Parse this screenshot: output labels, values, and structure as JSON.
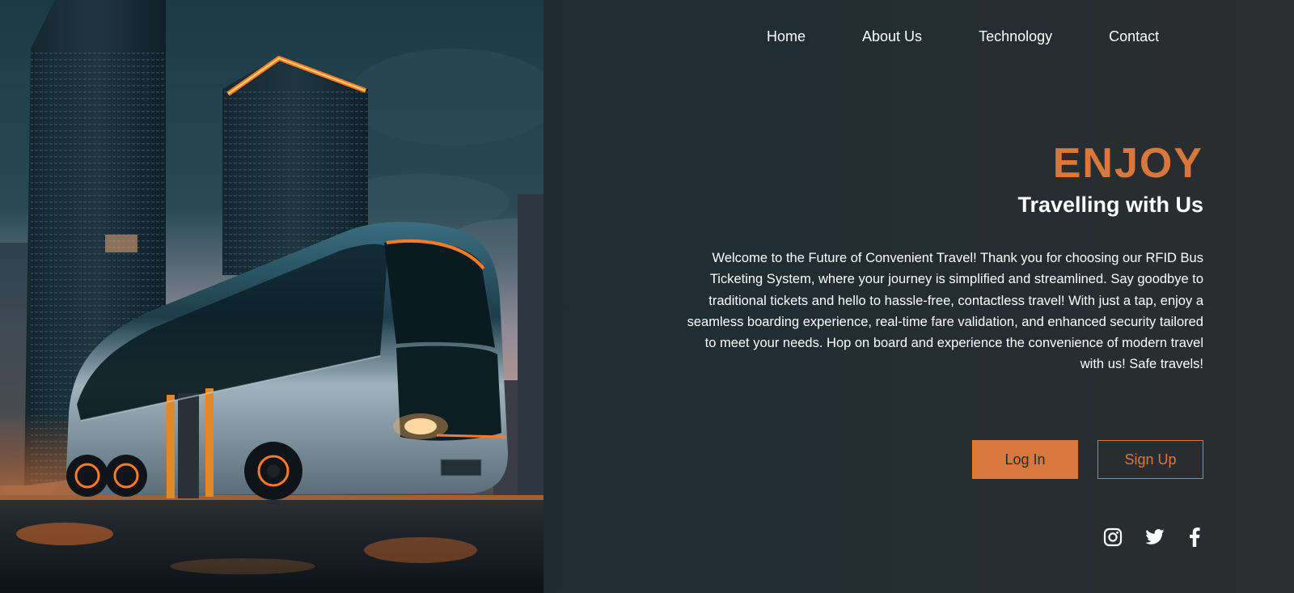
{
  "nav": {
    "items": [
      {
        "label": "Home"
      },
      {
        "label": "About Us"
      },
      {
        "label": "Technology"
      },
      {
        "label": "Contact"
      }
    ]
  },
  "hero": {
    "headline": "ENJOY",
    "subheadline": "Travelling with Us",
    "intro": "Welcome to the Future of Convenient Travel! Thank you for choosing our RFID Bus Ticketing System, where your journey is simplified and streamlined. Say goodbye to traditional tickets and hello to hassle-free, contactless travel! With just a tap, enjoy a seamless boarding experience, real-time fare validation, and enhanced security tailored to meet your needs. Hop on board and experience the convenience of modern travel with us! Safe travels!"
  },
  "actions": {
    "login_label": "Log In",
    "signup_label": "Sign Up"
  },
  "social": {
    "icons": [
      "instagram-icon",
      "twitter-icon",
      "facebook-icon"
    ]
  },
  "colors": {
    "accent": "#d9783c",
    "background": "#1e2b32",
    "text": "#ffffff"
  }
}
